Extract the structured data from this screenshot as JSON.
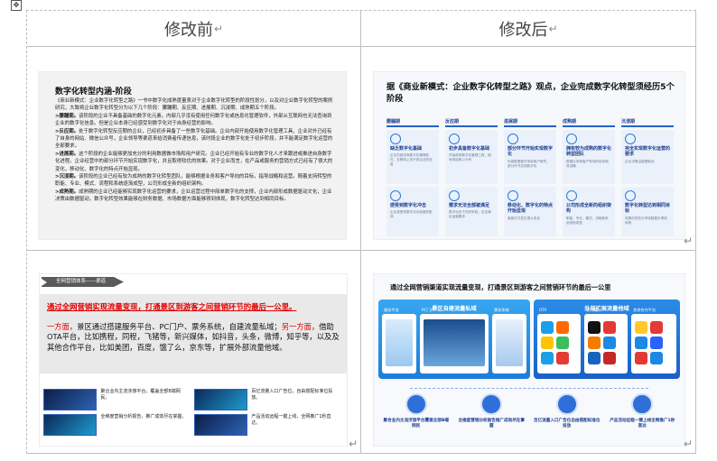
{
  "table": {
    "header_left": "修改前",
    "header_right": "修改后",
    "para_mark": "↵"
  },
  "slide1": {
    "title": "数字化转型内涵-阶段",
    "intro": "《商业新模式：企业数字化转型之路》一书中数字化成熟度量表对于企业数字化转型的阶段性划分，以及对企业数字化转型的案例研究，大致将企业数字化转型分为以下几个阶段：腰蹦期、反应期、进展期、沉浸期、成熟期五个阶段。",
    "items": [
      {
        "label": ">腰蹦期。",
        "text": "该阶段的企业不具备基础的数字化元素，内部几乎没有使用任何数字化或信息化管理软件，外部从互联网也无法查询到企业的数字化信息。但是企业本身已经感受到数字化对于自身经营的影响。"
      },
      {
        "label": ">反应期。",
        "text": "处于数字化转型反应期的企业，已经初步具备了一些数字化基础。企业内部开始使用数字化管理工具，企业对外已经有了自身的网站、微信公众号，企业领导等渠道来给消费者传递信息，该时段企业的数字化处于初步阶段，并不能满足数字化运营的全部要求。"
      },
      {
        "label": ">进展期。",
        "text": "这个阶段的企业能够更加充分的利用数据做市场和用户研究。企业已经开始有专业的数字化人才来跟进或推进自身数字化进程。企业经营中的部分环节开始实现数字化，并且取得较优的效果。对于企业而言，在产品或服务的营销方式已经有了很大的变化，移动化、数字化的特点开始显现。"
      },
      {
        "label": ">沉浸期。",
        "text": "该阶段的企业已经有较为成熟的数字化转型团队，能够根据业务和客户导向的目标，指导战略和运营。随着支持转型的职能、专业、模式、流程和系统逐渐成型，公司形成全新的组织架构。"
      },
      {
        "label": ">成熟期。",
        "text": "成熟期的企业已经能够实现数字化运营的要求，企业运营过程中简单数字化的支撑，企业内部形成数据驱动文化，企业决策由数据驱动，数字化转型效果能够在财务数据、市场数据方面能够得到体现，数字化转型达到相同目标。"
      }
    ]
  },
  "slide2": {
    "title": "据《商业新模式：企业数字化转型之路》观点，企业完成数字化转型须经历5个阶段",
    "phases": [
      {
        "label": "腰蹦期",
        "top_title": "缺乏数字化基础",
        "top_desc": "企业内部没有数字化管理软件，互联网上查不到企业的信息",
        "bottom_title": "感受到数字化冲击",
        "bottom_desc": "企业感受到数字化对经营的影响"
      },
      {
        "label": "反应期",
        "top_title": "初步具备数字化基础",
        "top_desc": "开始使用数字化管理工具，拥有网站和公众号",
        "bottom_title": "需求无法全部被满足",
        "bottom_desc": "数字化处于初步阶段，无法满足运营要求"
      },
      {
        "label": "进展期",
        "top_title": "部分环节开始实现数字化",
        "top_desc": "利用数据做市场和用户研究，部分环节实现数字化",
        "bottom_title": "移动化、数字化的特点开始显现",
        "bottom_desc": "营销方式发生很大变化"
      },
      {
        "label": "成熟期",
        "top_title": "拥有较为成熟的数字化转型团队",
        "top_desc": "根据业务和客户导向的目标指导战略",
        "bottom_title": "公司形成全新的组织架构",
        "bottom_desc": "职能、专业、模式、流程和系统逐渐成型"
      },
      {
        "label": "沉浸期",
        "top_title": "完全实现数字化运营的要求",
        "top_desc": "企业决策由数据驱动",
        "bottom_title": "数字化转型达到相同目标",
        "bottom_desc": "效果在财务与市场数据中得到体现"
      }
    ]
  },
  "slide3": {
    "tag": "全网营销体系——渠道",
    "headline": "通过全网营销实现流量变现，打通景区到游客之间营销环节的最后一公里。",
    "para_red": "一方面，",
    "para_text": "景区通过搭建服务平台、PC门户、票务系统，自建流量私域；",
    "para_red2": "另一方面，",
    "para_text2": "借助OTA平台，比如携程，同程，飞猪等，新兴媒体，如抖音，头条，微博，知乎等，以及及其他合作平台，比如美团，百度，饿了么，京东等，扩展外部流量他域。",
    "captions": [
      "聚合业内主流涉旅平台，覆盖全部B端网民。",
      "百亿流量入口广告位，自由搭配标准位投放。",
      "全维度营销分析报告，推广成效尽在掌握。",
      "产品活动远程一键上线，全网推广1秒直达。"
    ]
  },
  "slide4": {
    "title": "通过全网营销渠道实现流量变现，打通景区到游客之间营销环节的最后一公里",
    "panel_left": "景区自建流量私域",
    "panel_right": "外部扩展流量他域",
    "left_subs": [
      "服务平台",
      "PC门户",
      "票务系统"
    ],
    "right_subs": [
      "OTA",
      "新兴媒体",
      "其他合作平台"
    ],
    "bottom": [
      "聚合业内主流涉旅平台覆盖全部B端网民",
      "全维度营销分析报告推广成效尽在掌握",
      "百亿流量入口广告位自由搭配标准位投放",
      "产品活动远程一键上线全网推广1秒直达"
    ],
    "colors": {
      "blue": "#2f6fd8",
      "light_blue": "#38a6f0"
    }
  }
}
